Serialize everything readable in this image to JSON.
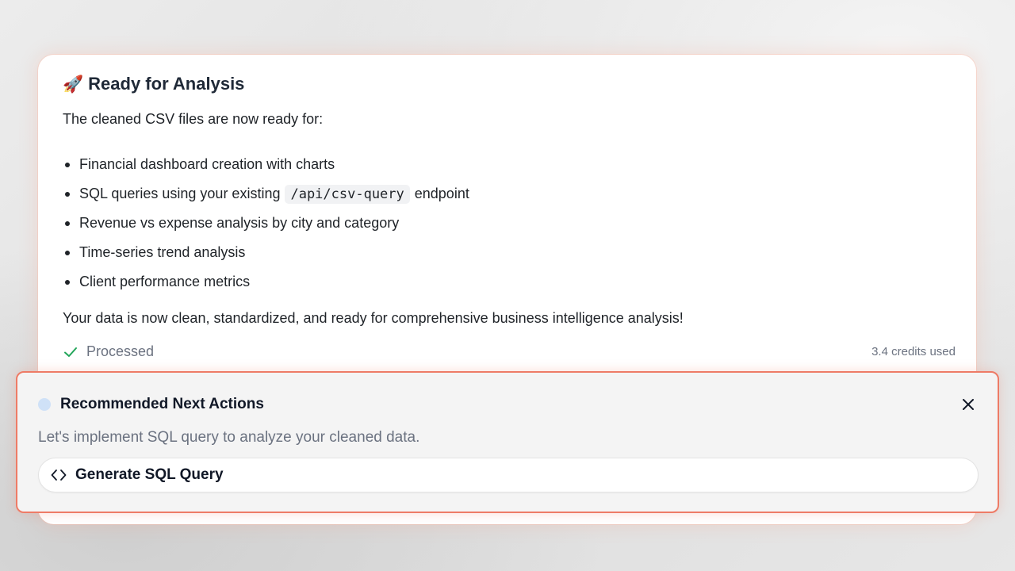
{
  "message": {
    "icon": "rocket-icon",
    "title_emoji": "🚀",
    "title": "Ready for Analysis",
    "intro": "The cleaned CSV files are now ready for:",
    "items": [
      {
        "text": "Financial dashboard creation with charts"
      },
      {
        "before": "SQL queries using your existing",
        "code": "/api/csv-query",
        "after": "endpoint"
      },
      {
        "text": "Revenue vs expense analysis by city and category"
      },
      {
        "text": "Time-series trend analysis"
      },
      {
        "text": "Client performance metrics"
      }
    ],
    "summary": "Your data is now clean, standardized, and ready for comprehensive business intelligence analysis!",
    "status_icon": "check-icon",
    "status": "Processed",
    "credits": "3.4 credits used"
  },
  "next_actions": {
    "title": "Recommended Next Actions",
    "subtitle": "Let's implement SQL query to analyze your cleaned data.",
    "close_icon": "close-icon",
    "action": {
      "icon": "code-icon",
      "label": "Generate SQL Query"
    }
  },
  "colors": {
    "accent_border": "#ee7b66",
    "check": "#22a559",
    "dot": "#cfe1f7"
  }
}
